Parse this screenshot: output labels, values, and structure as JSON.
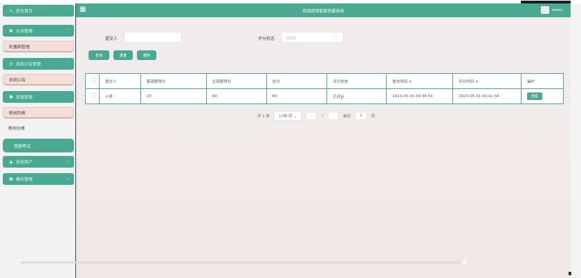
{
  "colors": {
    "accent": "#4aaa91",
    "sidebar_sub": "#f6ded8",
    "background": "#f1e7e4"
  },
  "sidebar": {
    "home": {
      "label": "后台首页",
      "icon": "home-icon"
    },
    "items": [
      {
        "label": "公共管理",
        "icon": "mail-icon",
        "type": "group",
        "open": true
      },
      {
        "label": "轮播图管理",
        "type": "sub"
      },
      {
        "label": "系统公告管理",
        "icon": "info-icon",
        "type": "group",
        "open": true
      },
      {
        "label": "系统公告",
        "type": "sub"
      },
      {
        "label": "资源管理",
        "icon": "pin-icon",
        "type": "group",
        "open": true
      },
      {
        "label": "新闻列表",
        "type": "sub"
      },
      {
        "label": "新闻分类",
        "type": "plain"
      },
      {
        "label": "答题考试",
        "type": "active"
      },
      {
        "label": "系统用户",
        "icon": "user-icon",
        "type": "group",
        "open": false
      },
      {
        "label": "模块管理",
        "icon": "grid-icon",
        "type": "group",
        "open": false
      }
    ]
  },
  "header": {
    "title": "欢迎使用智能答疑系统",
    "user": "admin"
  },
  "search": {
    "submitter_label": "提交人",
    "submitter_value": "",
    "status_label": "评分状态",
    "status_placeholder": "请选择"
  },
  "toolbar": {
    "query": "查询",
    "reset": "重置",
    "delete": "删除"
  },
  "table": {
    "headers": [
      "提交人",
      "客观题得分",
      "主观题得分",
      "总分",
      "评分状态",
      "提交时间 ≎",
      "评分时间 ≎",
      "操作"
    ],
    "rows": [
      {
        "submitter": "小李",
        "objective": "20",
        "subjective": "60",
        "total": "80",
        "status": "已评分",
        "submit_time": "2023-05-31 09:36:59",
        "score_time": "2023-05-31 09:41:34",
        "action": "查看"
      }
    ]
  },
  "pagination": {
    "total": "共 1 条",
    "page_size": "10条/页",
    "prev": "‹",
    "current": "1",
    "next": "›",
    "goto_label": "前往",
    "goto_value": "1",
    "page_unit": "页"
  }
}
